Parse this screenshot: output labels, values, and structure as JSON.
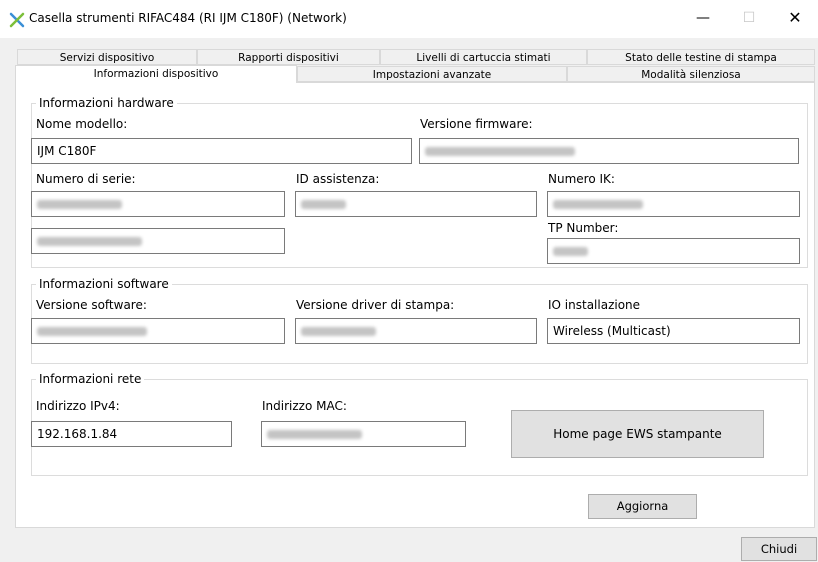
{
  "window": {
    "title": "Casella strumenti RIFAC484 (RI IJM C180F) (Network)",
    "minimize_symbol": "—",
    "maximize_symbol": "☐",
    "close_symbol": "✕",
    "icon": "toolbox-cross-icon"
  },
  "tabs": {
    "row1": [
      "Servizi dispositivo",
      "Rapporti dispositivi",
      "Livelli di cartuccia stimati",
      "Stato delle testine di stampa"
    ],
    "row2": [
      "Informazioni dispositivo",
      "Impostazioni avanzate",
      "Modalità silenziosa"
    ],
    "active": "Informazioni dispositivo"
  },
  "hardware": {
    "legend": "Informazioni hardware",
    "model_label": "Nome modello:",
    "model_value": "IJM C180F",
    "firmware_label": "Versione firmware:",
    "serial_label": "Numero di serie:",
    "assist_label": "ID assistenza:",
    "ik_label": "Numero IK:",
    "tp_label": "TP Number:"
  },
  "software": {
    "legend": "Informazioni software",
    "sw_label": "Versione software:",
    "driver_label": "Versione driver di stampa:",
    "install_label": "IO installazione",
    "install_value": "Wireless (Multicast)"
  },
  "network": {
    "legend": "Informazioni rete",
    "ipv4_label": "Indirizzo IPv4:",
    "ipv4_value": "192.168.1.84",
    "mac_label": "Indirizzo MAC:",
    "ews_button": "Home page EWS stampante"
  },
  "buttons": {
    "refresh": "Aggiorna",
    "close": "Chiudi"
  }
}
